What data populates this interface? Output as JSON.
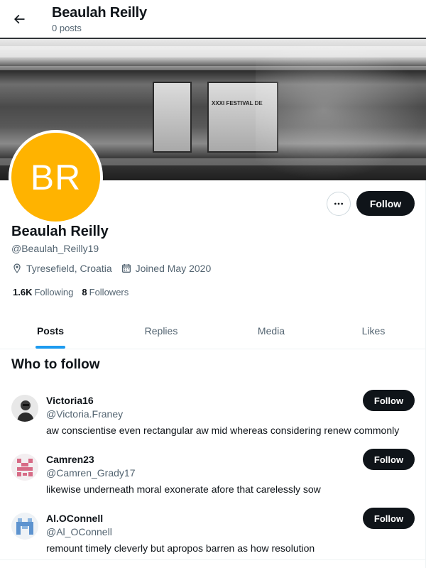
{
  "header": {
    "title": "Beaulah Reilly",
    "subtitle": "0 posts"
  },
  "banner": {
    "poster_text": "XXXI FESTIVAL DE"
  },
  "profile": {
    "avatar_initials": "BR",
    "avatar_color": "#ffb300",
    "name": "Beaulah Reilly",
    "handle": "@Beaulah_Reilly19",
    "location": "Tyresefield, Croatia",
    "joined": "Joined May 2020",
    "following_count": "1.6K",
    "following_label": "Following",
    "followers_count": "8",
    "followers_label": "Followers",
    "follow_label": "Follow",
    "more_label": "···"
  },
  "tabs": [
    {
      "label": "Posts",
      "active": true
    },
    {
      "label": "Replies",
      "active": false
    },
    {
      "label": "Media",
      "active": false
    },
    {
      "label": "Likes",
      "active": false
    }
  ],
  "who_to_follow": {
    "title": "Who to follow",
    "users": [
      {
        "name": "Victoria16",
        "handle": "@Victoria.Franey",
        "bio": "aw conscientise even rectangular aw mid whereas considering renew commonly",
        "follow_label": "Follow",
        "avatar": "photo-icon"
      },
      {
        "name": "Camren23",
        "handle": "@Camren_Grady17",
        "bio": "likewise underneath moral exonerate afore that carelessly sow",
        "follow_label": "Follow",
        "avatar": "identicon-pink"
      },
      {
        "name": "Al.OConnell",
        "handle": "@Al_OConnell",
        "bio": "remount timely cleverly but apropos barren as how resolution",
        "follow_label": "Follow",
        "avatar": "identicon-blue"
      }
    ]
  },
  "colors": {
    "accent": "#1d9bf0",
    "text": "#0f1419",
    "secondary": "#536471",
    "button": "#0f1419"
  }
}
